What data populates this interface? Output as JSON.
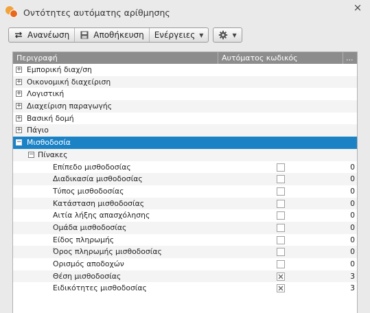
{
  "window": {
    "title": "Οντότητες αυτόματης αρίθμησης",
    "close_glyph": "×"
  },
  "toolbar": {
    "refresh_label": "Ανανέωση",
    "save_label": "Αποθήκευση",
    "actions_label": "Ενέργειες",
    "refresh_icon": "refresh-icon",
    "save_icon": "save-icon",
    "settings_icon": "gear-icon"
  },
  "grid": {
    "columns": [
      "Περιγραφή",
      "Αυτόματος κωδικός",
      "..."
    ],
    "top_nodes": [
      {
        "label": "Εμπορική διαχ/ση",
        "expanded": false
      },
      {
        "label": "Οικονομική διαχείριση",
        "expanded": false
      },
      {
        "label": "Λογιστική",
        "expanded": false
      },
      {
        "label": "Διαχείριση παραγωγής",
        "expanded": false
      },
      {
        "label": "Βασική δομή",
        "expanded": false
      },
      {
        "label": "Πάγιο",
        "expanded": false
      },
      {
        "label": "Μισθοδοσία",
        "expanded": true,
        "selected": true
      }
    ],
    "child_group": {
      "label": "Πίνακες",
      "expanded": true
    },
    "leaves": [
      {
        "label": "Επίπεδο μισθοδοσίας",
        "auto": false,
        "value": "0"
      },
      {
        "label": "Διαδικασία μισθοδοσίας",
        "auto": false,
        "value": "0"
      },
      {
        "label": "Τύπος μισθοδοσίας",
        "auto": false,
        "value": "0"
      },
      {
        "label": "Κατάσταση μισθοδοσίας",
        "auto": false,
        "value": "0"
      },
      {
        "label": "Αιτία λήξης απασχόλησης",
        "auto": false,
        "value": "0"
      },
      {
        "label": "Ομάδα μισθοδοσίας",
        "auto": false,
        "value": "0"
      },
      {
        "label": "Είδος πληρωμής",
        "auto": false,
        "value": "0"
      },
      {
        "label": "Όρος πληρωμής μισθοδοσίας",
        "auto": false,
        "value": "0"
      },
      {
        "label": "Ορισμός αποδοχών",
        "auto": false,
        "value": "0"
      },
      {
        "label": "Θέση μισθοδοσίας",
        "auto": true,
        "value": "3"
      },
      {
        "label": "Ειδικότητες μισθοδοσίας",
        "auto": true,
        "value": "3"
      }
    ]
  },
  "colors": {
    "selected_row": "#1b82c6",
    "header_bg": "#8c8c8c"
  }
}
